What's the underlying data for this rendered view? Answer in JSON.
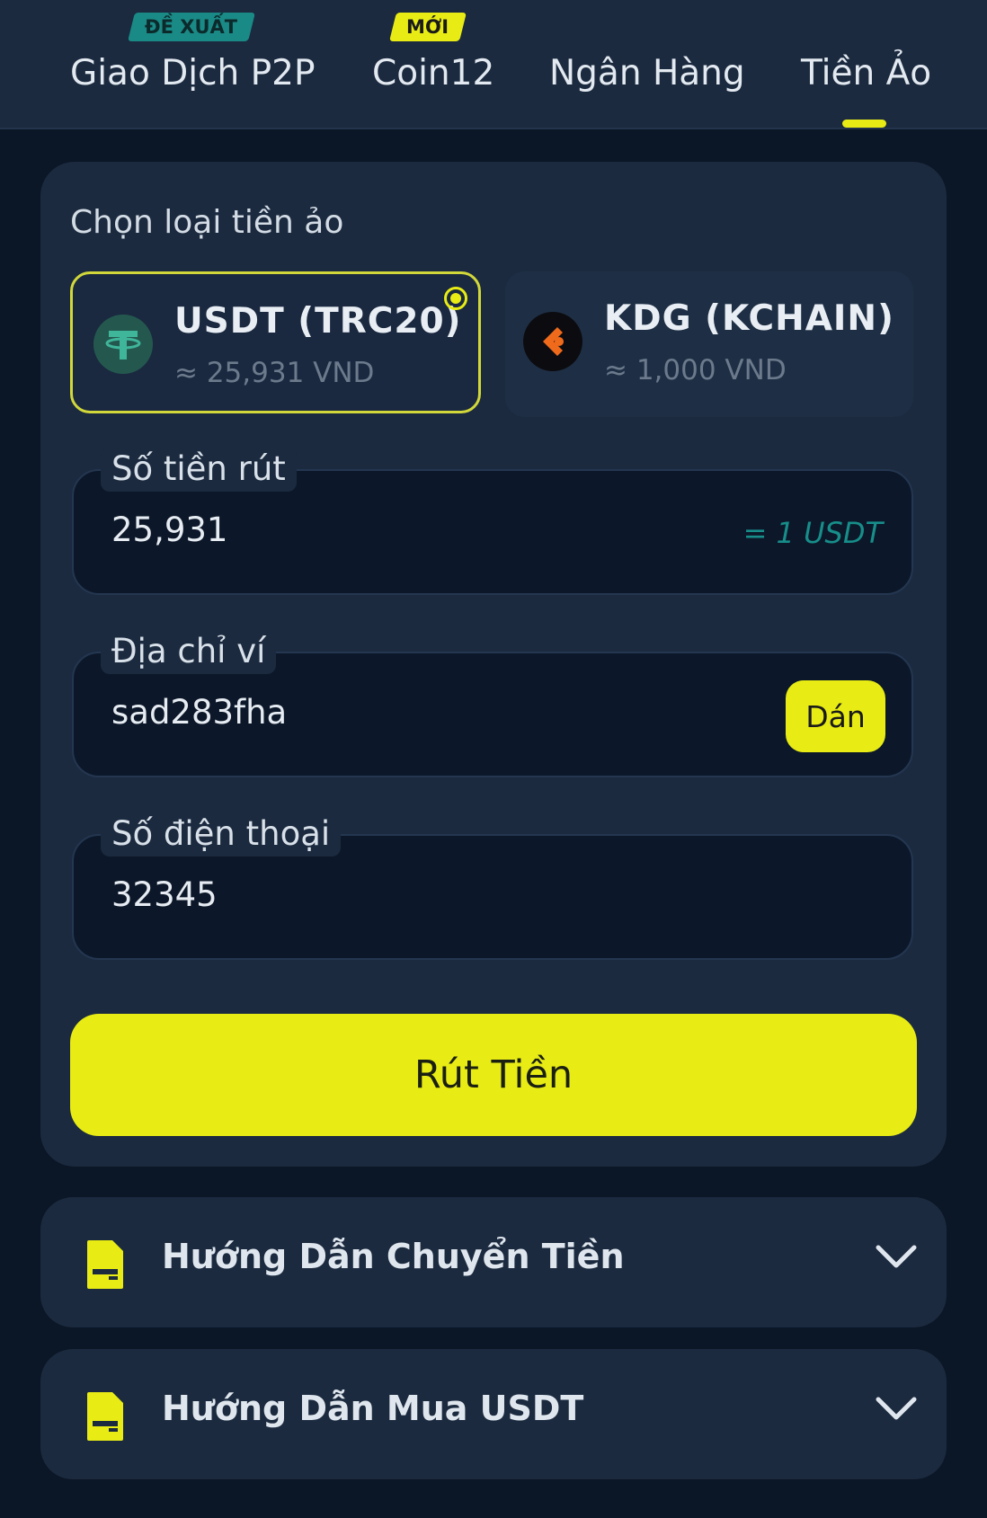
{
  "tabs": [
    {
      "label": "Giao Dịch P2P",
      "tag": "ĐỀ XUẤT"
    },
    {
      "label": "Coin12",
      "tag": "MỚI"
    },
    {
      "label": "Ngân Hàng"
    },
    {
      "label": "Tiền Ảo",
      "active": true
    }
  ],
  "crypto": {
    "section_label": "Chọn loại tiền ảo",
    "options": [
      {
        "name": "USDT (TRC20)",
        "rate": "≈ 25,931 VND",
        "selected": true,
        "icon": "tether-icon"
      },
      {
        "name": "KDG (KCHAIN)",
        "rate": "≈ 1,000 VND",
        "selected": false,
        "icon": "kdg-icon"
      }
    ]
  },
  "form": {
    "amount": {
      "label": "Số tiền rút",
      "value": "25,931",
      "equivalent": "= 1 USDT"
    },
    "wallet": {
      "label": "Địa chỉ ví",
      "value": "sad283fha",
      "paste_label": "Dán"
    },
    "phone": {
      "label": "Số điện thoại",
      "value": "32345"
    },
    "submit_label": "Rút Tiền"
  },
  "guides": [
    {
      "title": "Hướng Dẫn Chuyển Tiền",
      "icon": "document-icon"
    },
    {
      "title": "Hướng Dẫn Mua USDT",
      "icon": "document-icon"
    }
  ],
  "colors": {
    "accent": "#e8ec14",
    "background": "#0b1626",
    "card": "#1b2a3f",
    "teal": "#178e8a"
  }
}
